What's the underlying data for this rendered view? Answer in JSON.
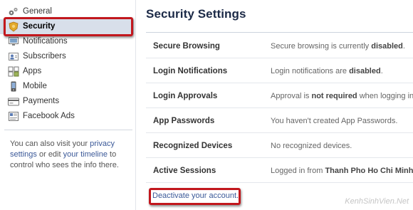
{
  "sidebar": {
    "items": [
      {
        "label": "General",
        "icon": "gears-icon"
      },
      {
        "label": "Security",
        "icon": "shield-badge-icon",
        "selected": true
      },
      {
        "label": "Notifications",
        "icon": "notification-monitor-icon"
      },
      {
        "label": "Subscribers",
        "icon": "subscribers-icon"
      },
      {
        "label": "Apps",
        "icon": "apps-blocks-icon"
      },
      {
        "label": "Mobile",
        "icon": "mobile-phone-icon"
      },
      {
        "label": "Payments",
        "icon": "credit-card-icon"
      },
      {
        "label": "Facebook Ads",
        "icon": "ads-icon"
      }
    ],
    "note": {
      "prefix": "You can also visit your ",
      "privacy_link": "privacy settings",
      "middle": " or edit ",
      "timeline_link": "your timeline",
      "suffix": " to control who sees the info there."
    }
  },
  "main": {
    "title": "Security Settings",
    "rows": [
      {
        "name": "Secure Browsing",
        "value_prefix": "Secure browsing is currently ",
        "value_bold": "disabled",
        "value_suffix": "."
      },
      {
        "name": "Login Notifications",
        "value_prefix": "Login notifications are ",
        "value_bold": "disabled",
        "value_suffix": "."
      },
      {
        "name": "Login Approvals",
        "value_prefix": "Approval is ",
        "value_bold": "not required",
        "value_suffix": " when logging in"
      },
      {
        "name": "App Passwords",
        "value_prefix": "You haven't created App Passwords.",
        "value_bold": "",
        "value_suffix": ""
      },
      {
        "name": "Recognized Devices",
        "value_prefix": "No recognized devices.",
        "value_bold": "",
        "value_suffix": ""
      },
      {
        "name": "Active Sessions",
        "value_prefix": "Logged in from ",
        "value_bold": "Thanh Pho Ho Chi Minh",
        "value_suffix": ""
      }
    ],
    "deactivate_link": "Deactivate your account."
  },
  "watermark": "KenhSinhVien.Net",
  "colors": {
    "highlight": "#c2171d",
    "link": "#3b5998",
    "selected_bg": "#d8dfea",
    "title": "#1c2a47"
  }
}
